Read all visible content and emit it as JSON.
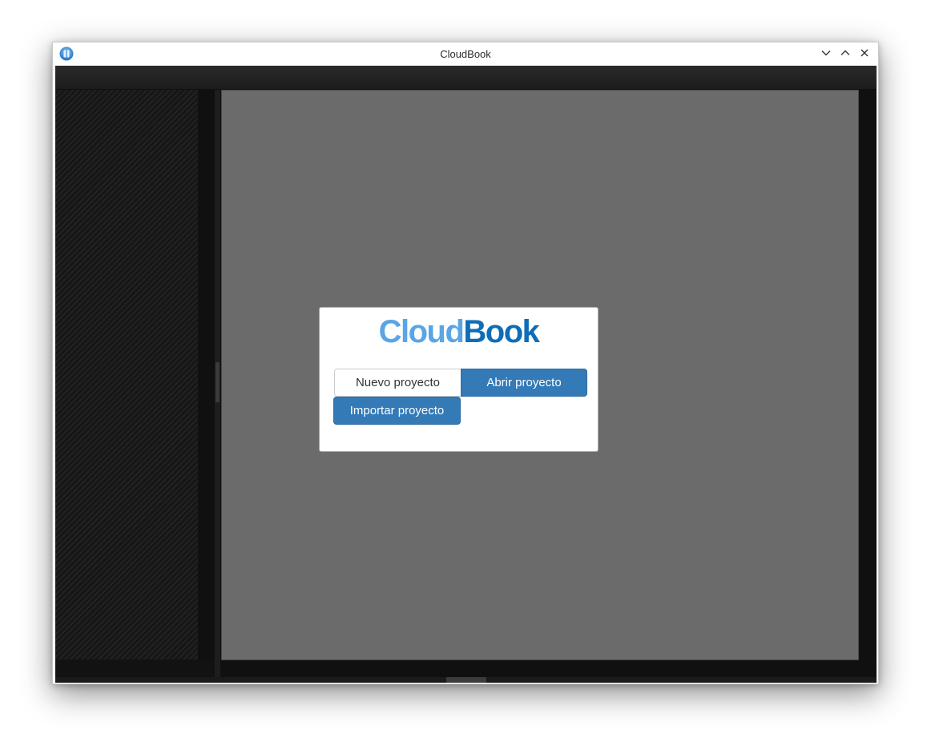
{
  "window": {
    "title": "CloudBook",
    "app_icon": "cloudbook-app-icon",
    "controls": {
      "minimize_icon": "chevron-down-icon",
      "maximize_icon": "chevron-up-icon",
      "close_icon": "close-icon"
    }
  },
  "dialog": {
    "logo": {
      "part_cloud": "Cloud",
      "part_book": "Book",
      "color_cloud": "#5aa5e6",
      "color_book": "#0f6db7"
    },
    "buttons": {
      "new_project": "Nuevo proyecto",
      "open_project": "Abrir proyecto",
      "import_project": "Importar proyecto"
    }
  },
  "colors": {
    "primary_button": "#337ab7",
    "canvas": "#6b6b6b",
    "workspace_background": "#101010"
  }
}
